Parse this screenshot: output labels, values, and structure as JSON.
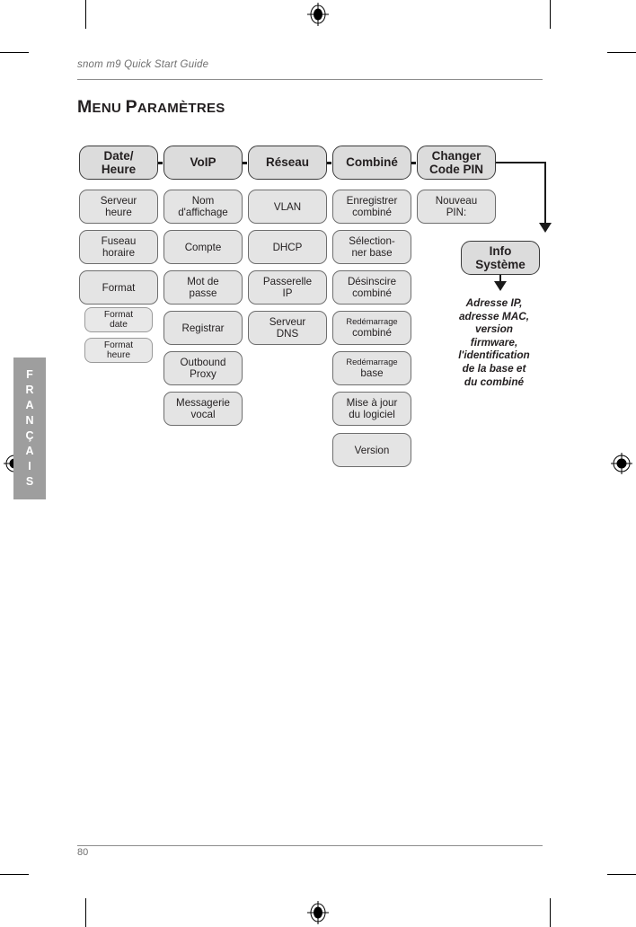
{
  "document": {
    "running_head": "snom m9 Quick Start Guide",
    "title_first_letter": "M",
    "title_rest_1": "ENU ",
    "title_second_letter": "P",
    "title_rest_2": "ARAMÈTRES",
    "title_full": "Menu Paramètres",
    "page_number": "80",
    "language_tab": "FRANÇAIS",
    "language_tab_letters": [
      "F",
      "R",
      "A",
      "N",
      "Ç",
      "A",
      "I",
      "S"
    ]
  },
  "colors": {
    "node_fill": "#e4e4e4",
    "node_border": "#6e6e6e",
    "top_node_fill": "#dcdcdc",
    "top_node_border": "#3a3a3a",
    "tab_background": "#9e9e9e",
    "rule": "#8d8d8d",
    "text": "#231f20",
    "muted_text": "#6f6f6f",
    "connector": "#1a1a1a"
  },
  "diagram": {
    "type": "menu-tree",
    "columns": [
      {
        "id": "date-heure",
        "header": {
          "line1": "Date/",
          "line2": "Heure"
        },
        "items": [
          {
            "line1": "Serveur",
            "line2": "heure"
          },
          {
            "line1": "Fuseau",
            "line2": "horaire"
          },
          {
            "line1": "Format",
            "line2": ""
          }
        ],
        "subitems": [
          {
            "line1": "Format",
            "line2": "date"
          },
          {
            "line1": "Format",
            "line2": "heure"
          }
        ]
      },
      {
        "id": "voip",
        "header": {
          "line1": "VoIP",
          "line2": ""
        },
        "items": [
          {
            "line1": "Nom",
            "line2": "d'affichage"
          },
          {
            "line1": "Compte",
            "line2": ""
          },
          {
            "line1": "Mot de",
            "line2": "passe"
          },
          {
            "line1": "Registrar",
            "line2": ""
          },
          {
            "line1": "Outbound",
            "line2": "Proxy"
          },
          {
            "line1": "Messagerie",
            "line2": "vocal"
          }
        ],
        "subitems": []
      },
      {
        "id": "reseau",
        "header": {
          "line1": "Réseau",
          "line2": ""
        },
        "items": [
          {
            "line1": "VLAN",
            "line2": ""
          },
          {
            "line1": "DHCP",
            "line2": ""
          },
          {
            "line1": "Passerelle",
            "line2": "IP"
          },
          {
            "line1": "Serveur",
            "line2": "DNS"
          }
        ],
        "subitems": []
      },
      {
        "id": "combine",
        "header": {
          "line1": "Combiné",
          "line2": ""
        },
        "items": [
          {
            "line1": "Enregistrer",
            "line2": "combiné"
          },
          {
            "line1": "Sélection-",
            "line2": "ner base"
          },
          {
            "line1": "Désinscire",
            "line2": "combiné"
          },
          {
            "line1": "Redémarrage",
            "line2": "combiné",
            "small_first": true
          },
          {
            "line1": "Redémarrage",
            "line2": "base",
            "small_first": true
          },
          {
            "line1": "Mise à jour",
            "line2": "du logiciel"
          },
          {
            "line1": "Version",
            "line2": ""
          }
        ],
        "subitems": []
      },
      {
        "id": "changer-code-pin",
        "header": {
          "line1": "Changer",
          "line2": "Code PIN"
        },
        "items": [
          {
            "line1": "Nouveau",
            "line2": "PIN:"
          }
        ],
        "subitems": []
      }
    ],
    "info_node": {
      "line1": "Info",
      "line2": "Système"
    },
    "info_caption": [
      "Adresse IP,",
      "adresse MAC,",
      "version",
      "firmware,",
      "l'identification",
      "de la base et",
      "du combiné"
    ]
  }
}
